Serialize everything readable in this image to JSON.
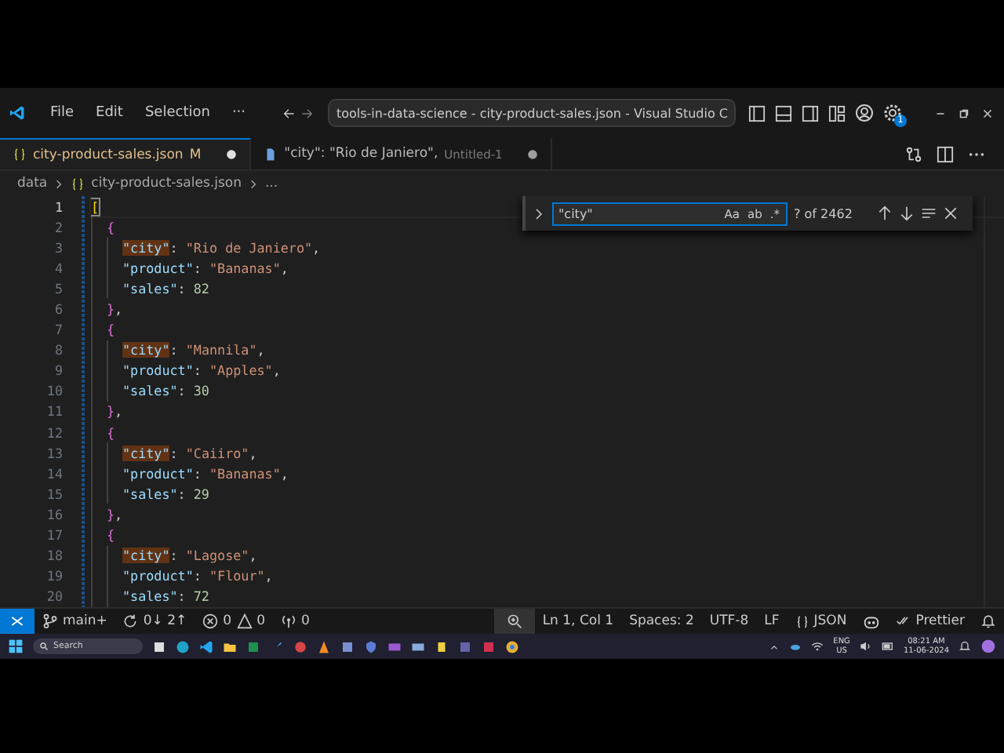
{
  "title_bar": {
    "menu": [
      "File",
      "Edit",
      "Selection",
      "···"
    ],
    "command_center": "tools-in-data-science - city-product-sales.json - Visual Studio C",
    "settings_badge": "1"
  },
  "tabs": [
    {
      "kind": "json",
      "label": "city-product-sales.json",
      "badge": "M",
      "dirty": true,
      "selected": true
    },
    {
      "kind": "untitled",
      "label": "\"city\": \"Rio de Janiero\",",
      "description": "Untitled-1",
      "dirty": true,
      "selected": false
    }
  ],
  "breadcrumb": {
    "items": [
      "data",
      "city-product-sales.json",
      "..."
    ]
  },
  "find": {
    "value": "\"city\"",
    "options": [
      "Aa",
      "ab",
      ".*"
    ],
    "result": "? of 2462"
  },
  "editor": {
    "lines": [
      {
        "number": "1",
        "kind": "root",
        "current": true,
        "tokens": [
          {
            "kind": "bracket",
            "text": "["
          }
        ]
      },
      {
        "number": "2",
        "kind": "object",
        "current": false,
        "tokens": [
          {
            "kind": "brace",
            "text": "{"
          }
        ]
      },
      {
        "number": "3",
        "kind": "member",
        "current": false,
        "tokens": [
          {
            "kind": "key",
            "text": "\"city\"",
            "match": true
          },
          {
            "kind": "punct",
            "text": ": "
          },
          {
            "kind": "string",
            "text": "\"Rio de Janiero\""
          },
          {
            "kind": "punct",
            "text": ","
          }
        ]
      },
      {
        "number": "4",
        "kind": "member",
        "current": false,
        "tokens": [
          {
            "kind": "key",
            "text": "\"product\"",
            "match": false
          },
          {
            "kind": "punct",
            "text": ": "
          },
          {
            "kind": "string",
            "text": "\"Bananas\""
          },
          {
            "kind": "punct",
            "text": ","
          }
        ]
      },
      {
        "number": "5",
        "kind": "member",
        "current": false,
        "tokens": [
          {
            "kind": "key",
            "text": "\"sales\"",
            "match": false
          },
          {
            "kind": "punct",
            "text": ": "
          },
          {
            "kind": "number",
            "text": "82"
          }
        ]
      },
      {
        "number": "6",
        "kind": "object",
        "current": false,
        "tokens": [
          {
            "kind": "brace",
            "text": "}"
          },
          {
            "kind": "punct",
            "text": ","
          }
        ]
      },
      {
        "number": "7",
        "kind": "object",
        "current": false,
        "tokens": [
          {
            "kind": "brace",
            "text": "{"
          }
        ]
      },
      {
        "number": "8",
        "kind": "member",
        "current": false,
        "tokens": [
          {
            "kind": "key",
            "text": "\"city\"",
            "match": true
          },
          {
            "kind": "punct",
            "text": ": "
          },
          {
            "kind": "string",
            "text": "\"Mannila\""
          },
          {
            "kind": "punct",
            "text": ","
          }
        ]
      },
      {
        "number": "9",
        "kind": "member",
        "current": false,
        "tokens": [
          {
            "kind": "key",
            "text": "\"product\"",
            "match": false
          },
          {
            "kind": "punct",
            "text": ": "
          },
          {
            "kind": "string",
            "text": "\"Apples\""
          },
          {
            "kind": "punct",
            "text": ","
          }
        ]
      },
      {
        "number": "10",
        "kind": "member",
        "current": false,
        "tokens": [
          {
            "kind": "key",
            "text": "\"sales\"",
            "match": false
          },
          {
            "kind": "punct",
            "text": ": "
          },
          {
            "kind": "number",
            "text": "30"
          }
        ]
      },
      {
        "number": "11",
        "kind": "object",
        "current": false,
        "tokens": [
          {
            "kind": "brace",
            "text": "}"
          },
          {
            "kind": "punct",
            "text": ","
          }
        ]
      },
      {
        "number": "12",
        "kind": "object",
        "current": false,
        "tokens": [
          {
            "kind": "brace",
            "text": "{"
          }
        ]
      },
      {
        "number": "13",
        "kind": "member",
        "current": false,
        "tokens": [
          {
            "kind": "key",
            "text": "\"city\"",
            "match": true
          },
          {
            "kind": "punct",
            "text": ": "
          },
          {
            "kind": "string",
            "text": "\"Caiiro\""
          },
          {
            "kind": "punct",
            "text": ","
          }
        ]
      },
      {
        "number": "14",
        "kind": "member",
        "current": false,
        "tokens": [
          {
            "kind": "key",
            "text": "\"product\"",
            "match": false
          },
          {
            "kind": "punct",
            "text": ": "
          },
          {
            "kind": "string",
            "text": "\"Bananas\""
          },
          {
            "kind": "punct",
            "text": ","
          }
        ]
      },
      {
        "number": "15",
        "kind": "member",
        "current": false,
        "tokens": [
          {
            "kind": "key",
            "text": "\"sales\"",
            "match": false
          },
          {
            "kind": "punct",
            "text": ": "
          },
          {
            "kind": "number",
            "text": "29"
          }
        ]
      },
      {
        "number": "16",
        "kind": "object",
        "current": false,
        "tokens": [
          {
            "kind": "brace",
            "text": "}"
          },
          {
            "kind": "punct",
            "text": ","
          }
        ]
      },
      {
        "number": "17",
        "kind": "object",
        "current": false,
        "tokens": [
          {
            "kind": "brace",
            "text": "{"
          }
        ]
      },
      {
        "number": "18",
        "kind": "member",
        "current": false,
        "tokens": [
          {
            "kind": "key",
            "text": "\"city\"",
            "match": true
          },
          {
            "kind": "punct",
            "text": ": "
          },
          {
            "kind": "string",
            "text": "\"Lagose\""
          },
          {
            "kind": "punct",
            "text": ","
          }
        ]
      },
      {
        "number": "19",
        "kind": "member",
        "current": false,
        "tokens": [
          {
            "kind": "key",
            "text": "\"product\"",
            "match": false
          },
          {
            "kind": "punct",
            "text": ": "
          },
          {
            "kind": "string",
            "text": "\"Flour\""
          },
          {
            "kind": "punct",
            "text": ","
          }
        ]
      },
      {
        "number": "20",
        "kind": "member",
        "current": false,
        "tokens": [
          {
            "kind": "key",
            "text": "\"sales\"",
            "match": false
          },
          {
            "kind": "punct",
            "text": ": "
          },
          {
            "kind": "number",
            "text": "72"
          }
        ]
      }
    ]
  },
  "status_bar": {
    "branch": "main+",
    "sync": "0↓ 2↑",
    "errors": "0",
    "warnings": "0",
    "ports": "0",
    "position": "Ln 1, Col 1",
    "indent": "Spaces: 2",
    "encoding": "UTF-8",
    "eol": "LF",
    "language": "JSON",
    "formatter": "Prettier"
  },
  "taskbar": {
    "search": "Search",
    "language": [
      "ENG",
      "US"
    ],
    "time": "08:21 AM",
    "date": "11-06-2024"
  }
}
